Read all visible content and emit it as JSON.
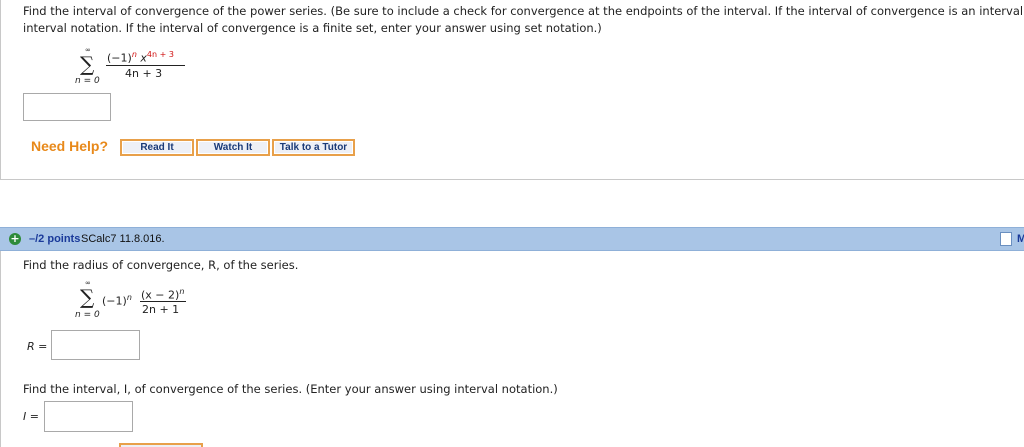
{
  "question1": {
    "instruction_line1": "Find the interval of convergence of the power series. (Be sure to include a check for convergence at the endpoints of the interval. If the interval of convergence is an interval, e",
    "instruction_line2": "interval notation. If the interval of convergence is a finite set, enter your answer using set notation.)",
    "series": {
      "sum_top": "∞",
      "sum_bottom": "n = 0",
      "numerator_base": "(−1)",
      "numerator_n": "n",
      "numerator_x": "x",
      "numerator_exponent": "4n + 3",
      "denominator": "4n + 3"
    },
    "answer_value": ""
  },
  "help": {
    "label": "Need Help?",
    "read_it": "Read It",
    "watch_it": "Watch It",
    "talk_to_tutor": "Talk to a Tutor"
  },
  "question2": {
    "header": {
      "points": "–/2 points",
      "source": "SCalc7 11.8.016.",
      "right_label": "M",
      "icons": [
        "plus-circle-icon",
        "note-icon"
      ]
    },
    "radius_prompt": "Find the radius of convergence, R, of the series.",
    "series": {
      "sum_top": "∞",
      "sum_bottom": "n = 0",
      "factor": "(−1)",
      "factor_n": "n",
      "numerator": "(x − 2)",
      "numerator_exp": "n",
      "denominator": "2n + 1"
    },
    "r_label": "R =",
    "r_value": "",
    "interval_prompt": "Find the interval, I, of convergence of the series. (Enter your answer using interval notation.)",
    "i_label": "I =",
    "i_value": ""
  },
  "colors": {
    "accent_orange": "#e8891a",
    "header_blue": "#a9c5e6",
    "points_blue": "#1a3a9a",
    "exponent_red": "#d01010"
  }
}
